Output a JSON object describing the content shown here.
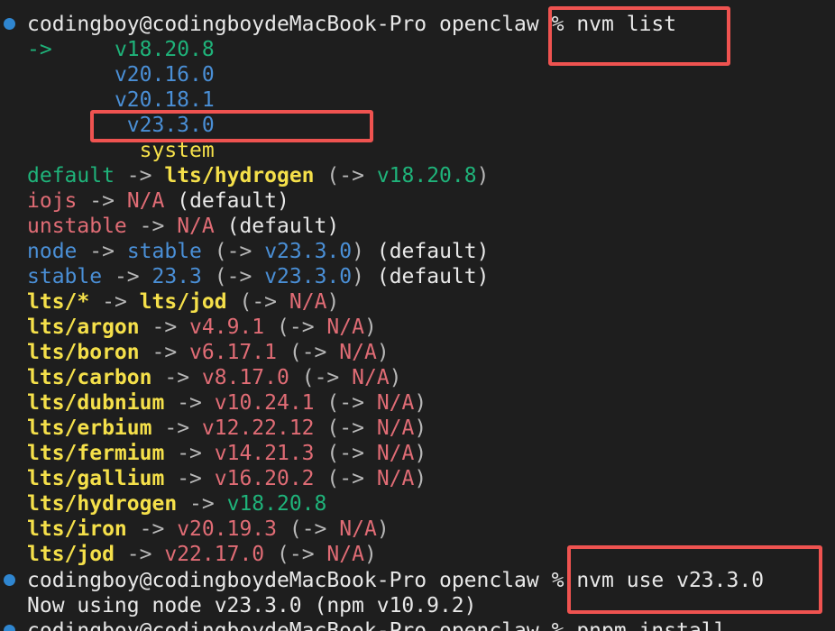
{
  "prompt": {
    "user_host": "codingboy@codingboydeMacBook-Pro",
    "cwd": "openclaw",
    "symbol": "%"
  },
  "commands": {
    "first": "nvm list",
    "second": "nvm use v23.3.0",
    "third": "pnpm install"
  },
  "nvm_list": {
    "current_marker": "->",
    "installed_versions": [
      "v18.20.8",
      "v20.16.0",
      "v20.18.1",
      "v23.3.0",
      "system"
    ],
    "aliases": [
      {
        "name": "default",
        "target": "lts/hydrogen",
        "resolved": "v18.20.8",
        "suffix": ""
      },
      {
        "name": "iojs",
        "target": "N/A",
        "resolved": "",
        "suffix": "(default)"
      },
      {
        "name": "unstable",
        "target": "N/A",
        "resolved": "",
        "suffix": "(default)"
      },
      {
        "name": "node",
        "target": "stable",
        "resolved": "v23.3.0",
        "suffix": "(default)"
      },
      {
        "name": "stable",
        "target": "23.3",
        "resolved": "v23.3.0",
        "suffix": "(default)"
      },
      {
        "name": "lts/*",
        "target": "lts/jod",
        "resolved": "N/A",
        "suffix": ""
      },
      {
        "name": "lts/argon",
        "target": "v4.9.1",
        "resolved": "N/A",
        "suffix": ""
      },
      {
        "name": "lts/boron",
        "target": "v6.17.1",
        "resolved": "N/A",
        "suffix": ""
      },
      {
        "name": "lts/carbon",
        "target": "v8.17.0",
        "resolved": "N/A",
        "suffix": ""
      },
      {
        "name": "lts/dubnium",
        "target": "v10.24.1",
        "resolved": "N/A",
        "suffix": ""
      },
      {
        "name": "lts/erbium",
        "target": "v12.22.12",
        "resolved": "N/A",
        "suffix": ""
      },
      {
        "name": "lts/fermium",
        "target": "v14.21.3",
        "resolved": "N/A",
        "suffix": ""
      },
      {
        "name": "lts/gallium",
        "target": "v16.20.2",
        "resolved": "N/A",
        "suffix": ""
      },
      {
        "name": "lts/hydrogen",
        "target": "v18.20.8",
        "resolved": "",
        "suffix": ""
      },
      {
        "name": "lts/iron",
        "target": "v20.19.3",
        "resolved": "N/A",
        "suffix": ""
      },
      {
        "name": "lts/jod",
        "target": "v22.17.0",
        "resolved": "N/A",
        "suffix": ""
      }
    ],
    "arrow": "->"
  },
  "nvm_use_output": "Now using node v23.3.0 (npm v10.9.2)",
  "colors": {
    "background": "#1e1e1e",
    "prompt_dot": "#2f86d0",
    "green": "#1fb37a",
    "blue": "#4a8fd6",
    "yellow": "#f5e04a",
    "red": "#e06c75",
    "highlight": "#ef5350"
  }
}
